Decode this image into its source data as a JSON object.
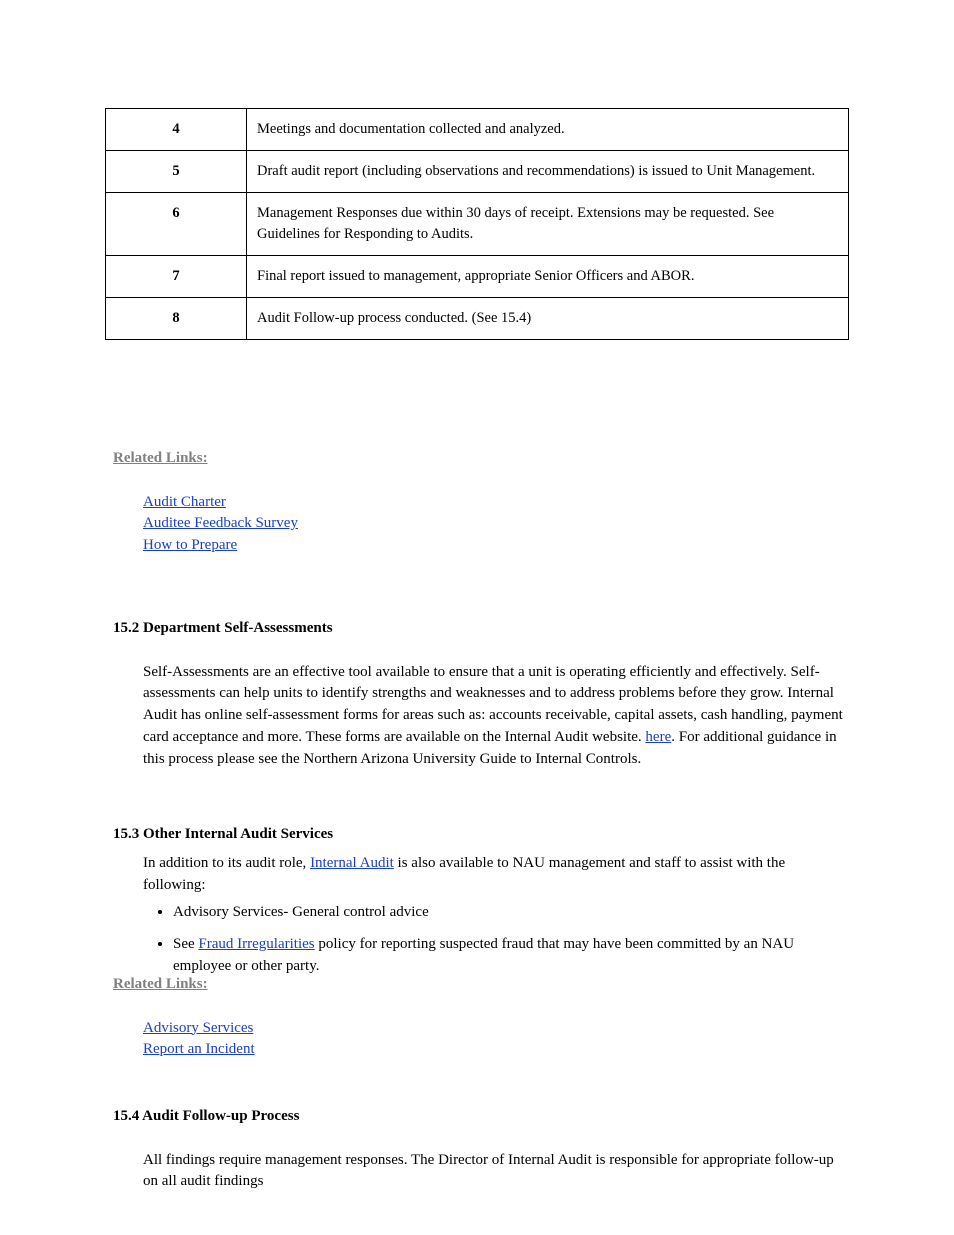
{
  "table": {
    "rows": [
      {
        "step": "4",
        "text": "Meetings and documentation collected and analyzed."
      },
      {
        "step": "5",
        "text": "Draft audit report (including observations and recommendations) is issued to Unit Management."
      },
      {
        "step": "6",
        "text": "Management Responses due within 30 days of receipt. Extensions may be requested. See Guidelines for Responding to Audits."
      },
      {
        "step": "7",
        "text": "Final report issued to management, appropriate Senior Officers and ABOR."
      },
      {
        "step": "8",
        "text": "Audit Follow-up process conducted. (See 15.4)"
      }
    ]
  },
  "relatedLinks1": {
    "heading": "Related Links:",
    "items": [
      {
        "label": "Audit Charter",
        "url": true
      },
      {
        "label": "Auditee Feedback Survey",
        "url": true
      },
      {
        "label": "How to Prepare",
        "url": true
      }
    ]
  },
  "section15_2": {
    "heading": "15.2 Department Self-Assessments",
    "body": "Self-Assessments are an effective tool available to ensure that a unit is operating efficiently and effectively. Self-assessments can help units to identify strengths and weaknesses and to address problems before they grow. Internal Audit has online self-assessment forms for areas such as:  accounts receivable, capital assets, cash handling, payment card acceptance and more. These forms are available on the Internal Audit website.",
    "linkWord": "here",
    "afterLink": ". For additional guidance in this process please see the Northern Arizona University Guide to Internal Controls."
  },
  "section15_3": {
    "heading": "15.3 Other Internal Audit Services",
    "intro": "In addition to its audit role, Internal Audit is also available to NAU management and staff to assist with the following:",
    "link": "Internal Audit",
    "bullets": [
      {
        "text": "Advisory Services- General control advice"
      },
      {
        "text": "See ",
        "linkLabel": "Fraud Irregularities",
        "suffix": " policy for reporting suspected fraud that may have been committed by an NAU employee or other party."
      }
    ]
  },
  "relatedLinks2": {
    "heading": "Related Links:",
    "items": [
      {
        "label": "Advisory Services",
        "url": true
      },
      {
        "label": "Report an Incident",
        "url": true
      }
    ]
  },
  "section15_4": {
    "heading": "15.4 Audit Follow-up Process",
    "body": "All findings require management responses. The Director of Internal Audit is responsible for appropriate follow-up on all audit findings"
  }
}
